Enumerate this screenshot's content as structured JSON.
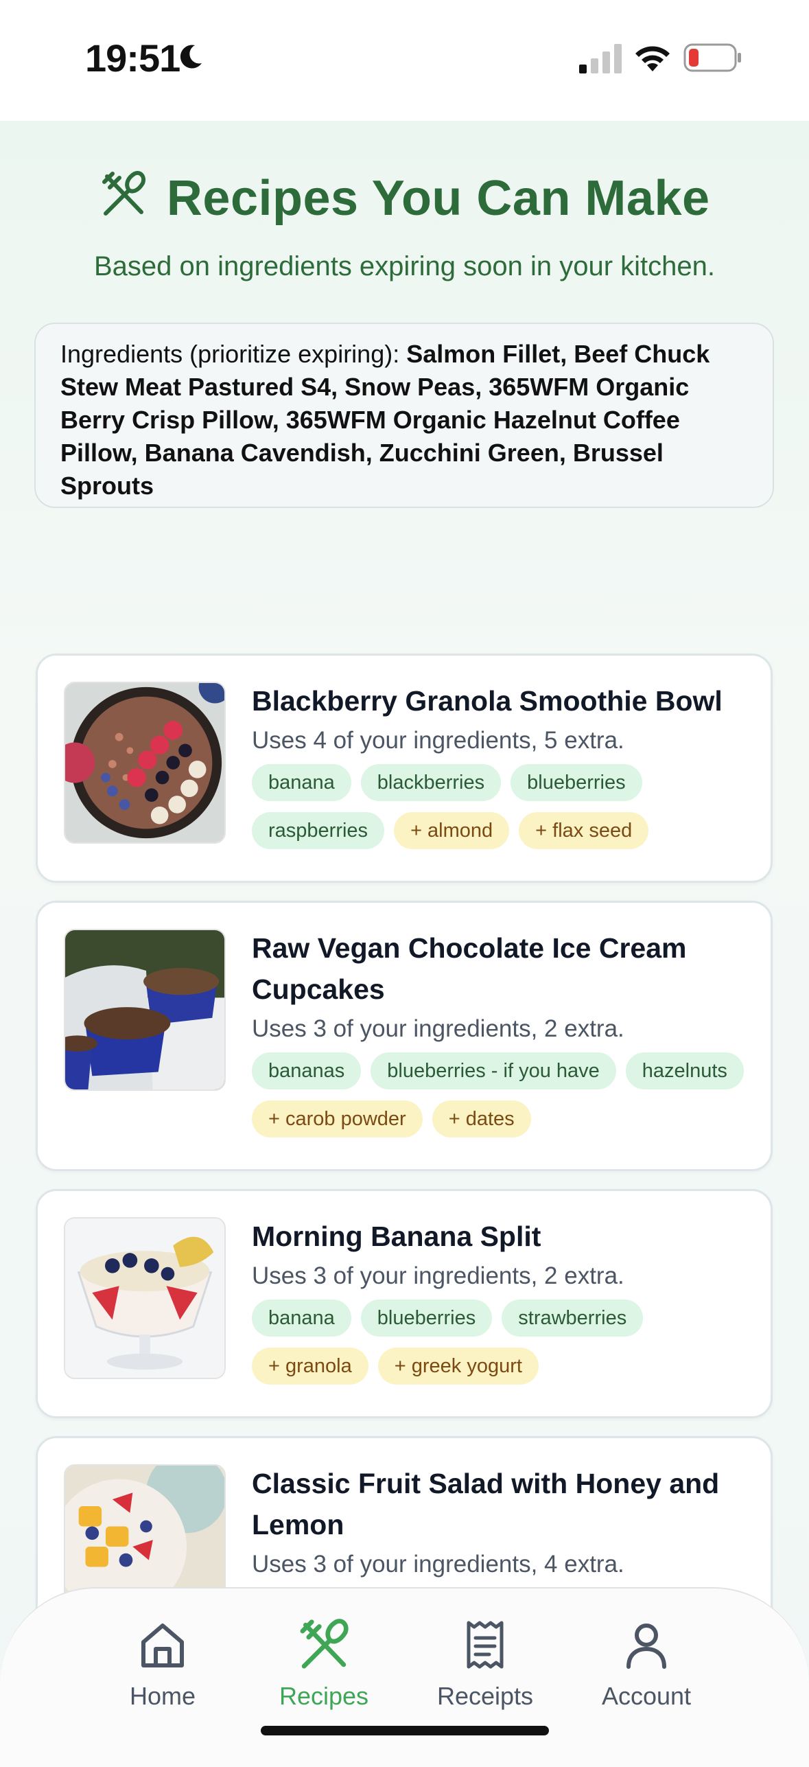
{
  "status_bar": {
    "time": "19:51"
  },
  "header": {
    "title": "Recipes You Can Make",
    "subtitle": "Based on ingredients expiring soon in your kitchen."
  },
  "ingredients": {
    "label": "Ingredients (prioritize expiring): ",
    "list": "Salmon Fillet, Beef Chuck Stew Meat Pastured S4, Snow Peas, 365WFM Organic Berry Crisp Pillow, 365WFM Organic Hazelnut Coffee Pillow, Banana Cavendish, Zucchini Green, Brussel Sprouts"
  },
  "recipes": [
    {
      "title": "Blackberry Granola Smoothie Bowl",
      "summary": "Uses 4 of your ingredients, 5 extra.",
      "have": [
        "banana",
        "blackberries",
        "blueberries",
        "raspberries"
      ],
      "extra": [
        "+ almond",
        "+ flax seed"
      ]
    },
    {
      "title": "Raw Vegan Chocolate Ice Cream Cupcakes",
      "summary": "Uses 3 of your ingredients, 2 extra.",
      "have": [
        "bananas",
        "blueberries - if you have",
        "hazelnuts"
      ],
      "extra": [
        "+ carob powder",
        "+ dates"
      ]
    },
    {
      "title": "Morning Banana Split",
      "summary": "Uses 3 of your ingredients, 2 extra.",
      "have": [
        "banana",
        "blueberries",
        "strawberries"
      ],
      "extra": [
        "+ granola",
        "+ greek yogurt"
      ]
    },
    {
      "title": "Classic Fruit Salad with Honey and Lemon",
      "summary": "Uses 3 of your ingredients, 4 extra.",
      "have": [],
      "extra": []
    }
  ],
  "nav": {
    "home": "Home",
    "recipes": "Recipes",
    "receipts": "Receipts",
    "account": "Account",
    "active": "recipes"
  },
  "colors": {
    "brand_green": "#2e6b3a",
    "active_green": "#3fa656",
    "tag_have_bg": "#dcf5e4",
    "tag_extra_bg": "#fcf3c4"
  }
}
